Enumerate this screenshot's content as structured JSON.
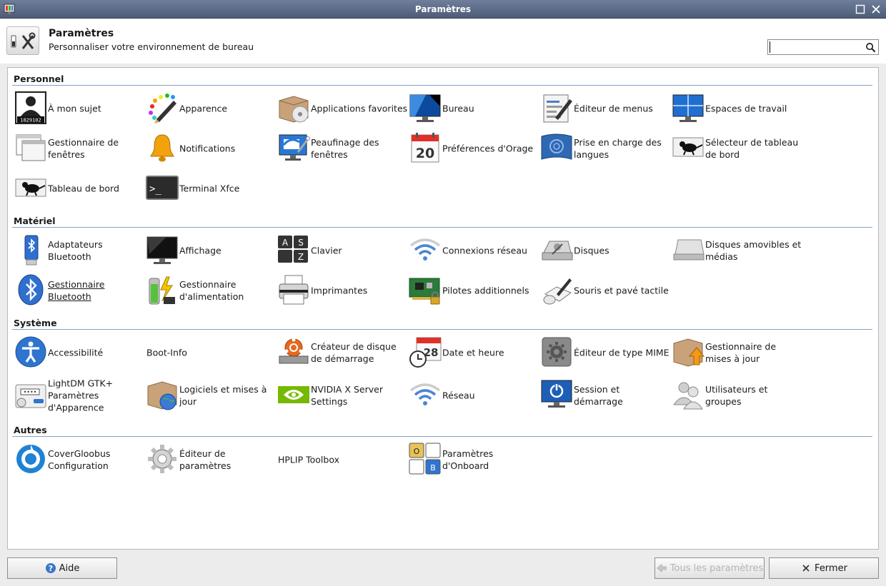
{
  "window": {
    "title": "Paramètres",
    "max_glyph": "☐",
    "close_glyph": "✕"
  },
  "header": {
    "title": "Paramètres",
    "subtitle": "Personnaliser votre environnement de bureau",
    "search_value": "",
    "search_placeholder": ""
  },
  "sections": {
    "personnel": {
      "title": "Personnel",
      "items": [
        {
          "label": "À mon sujet",
          "icon": "about-me-icon"
        },
        {
          "label": "Apparence",
          "icon": "appearance-icon"
        },
        {
          "label": "Applications favorites",
          "icon": "preferred-apps-icon"
        },
        {
          "label": "Bureau",
          "icon": "desktop-icon"
        },
        {
          "label": "Éditeur de menus",
          "icon": "menu-editor-icon"
        },
        {
          "label": "Espaces de travail",
          "icon": "workspaces-icon"
        },
        {
          "label": "Gestionnaire de fenêtres",
          "icon": "window-manager-icon"
        },
        {
          "label": "Notifications",
          "icon": "bell-icon"
        },
        {
          "label": "Peaufinage des fenêtres",
          "icon": "window-tweaks-icon"
        },
        {
          "label": "Préférences d'Orage",
          "icon": "calendar-icon"
        },
        {
          "label": "Prise en charge des langues",
          "icon": "language-icon"
        },
        {
          "label": "Sélecteur de tableau de bord",
          "icon": "panel-switch-icon"
        },
        {
          "label": "Tableau de bord",
          "icon": "panel-icon"
        },
        {
          "label": "Terminal Xfce",
          "icon": "terminal-icon"
        }
      ]
    },
    "materiel": {
      "title": "Matériel",
      "items": [
        {
          "label": "Adaptateurs Bluetooth",
          "icon": "bluetooth-adapter-icon"
        },
        {
          "label": "Affichage",
          "icon": "display-icon"
        },
        {
          "label": "Clavier",
          "icon": "keyboard-icon"
        },
        {
          "label": "Connexions réseau",
          "icon": "wifi-icon"
        },
        {
          "label": "Disques",
          "icon": "disks-icon"
        },
        {
          "label": "Disques amovibles et médias",
          "icon": "removable-drive-icon"
        },
        {
          "label": "Gestionnaire Bluetooth",
          "icon": "bluetooth-icon"
        },
        {
          "label": "Gestionnaire d'alimentation",
          "icon": "battery-icon"
        },
        {
          "label": "Imprimantes",
          "icon": "printer-icon"
        },
        {
          "label": "Pilotes additionnels",
          "icon": "driver-board-icon"
        },
        {
          "label": "Souris et pavé tactile",
          "icon": "mouse-icon"
        }
      ]
    },
    "systeme": {
      "title": "Système",
      "items": [
        {
          "label": "Accessibilité",
          "icon": "accessibility-icon"
        },
        {
          "label": "Boot-Info",
          "icon": ""
        },
        {
          "label": "Créateur de disque de démarrage",
          "icon": "startup-disk-icon"
        },
        {
          "label": "Date et heure",
          "icon": "date-time-icon"
        },
        {
          "label": "Éditeur de type MIME",
          "icon": "mime-gear-icon"
        },
        {
          "label": "Gestionnaire de mises à jour",
          "icon": "update-box-icon"
        },
        {
          "label": "LightDM GTK+ Paramètres d'Apparence",
          "icon": "login-screen-icon"
        },
        {
          "label": "Logiciels et mises à jour",
          "icon": "software-globe-icon"
        },
        {
          "label": "NVIDIA X Server Settings",
          "icon": "nvidia-icon"
        },
        {
          "label": "Réseau",
          "icon": "network-wifi-icon"
        },
        {
          "label": "Session et démarrage",
          "icon": "power-monitor-icon"
        },
        {
          "label": "Utilisateurs et groupes",
          "icon": "users-icon"
        }
      ]
    },
    "autres": {
      "title": "Autres",
      "items": [
        {
          "label": "CoverGloobus Configuration",
          "icon": "covergloobus-icon"
        },
        {
          "label": "Éditeur de paramètres",
          "icon": "settings-gear-icon"
        },
        {
          "label": "HPLIP Toolbox",
          "icon": ""
        },
        {
          "label": "Paramètres d'Onboard",
          "icon": "onboard-keys-icon"
        }
      ]
    }
  },
  "icon_text": {
    "about_me_number": "1829102",
    "calendar_day": "20",
    "terminal_prompt": ">_",
    "key_a": "A",
    "key_s": "S",
    "key_z": "Z",
    "date_day": "28",
    "onboard_o": "O",
    "onboard_b": "B"
  },
  "footer": {
    "help_label": "Aide",
    "all_settings_label": "Tous les paramètres",
    "close_label": "Fermer"
  },
  "colors": {
    "accent_rule": "#7ea3c6",
    "titlebar": "#5b6a87"
  }
}
